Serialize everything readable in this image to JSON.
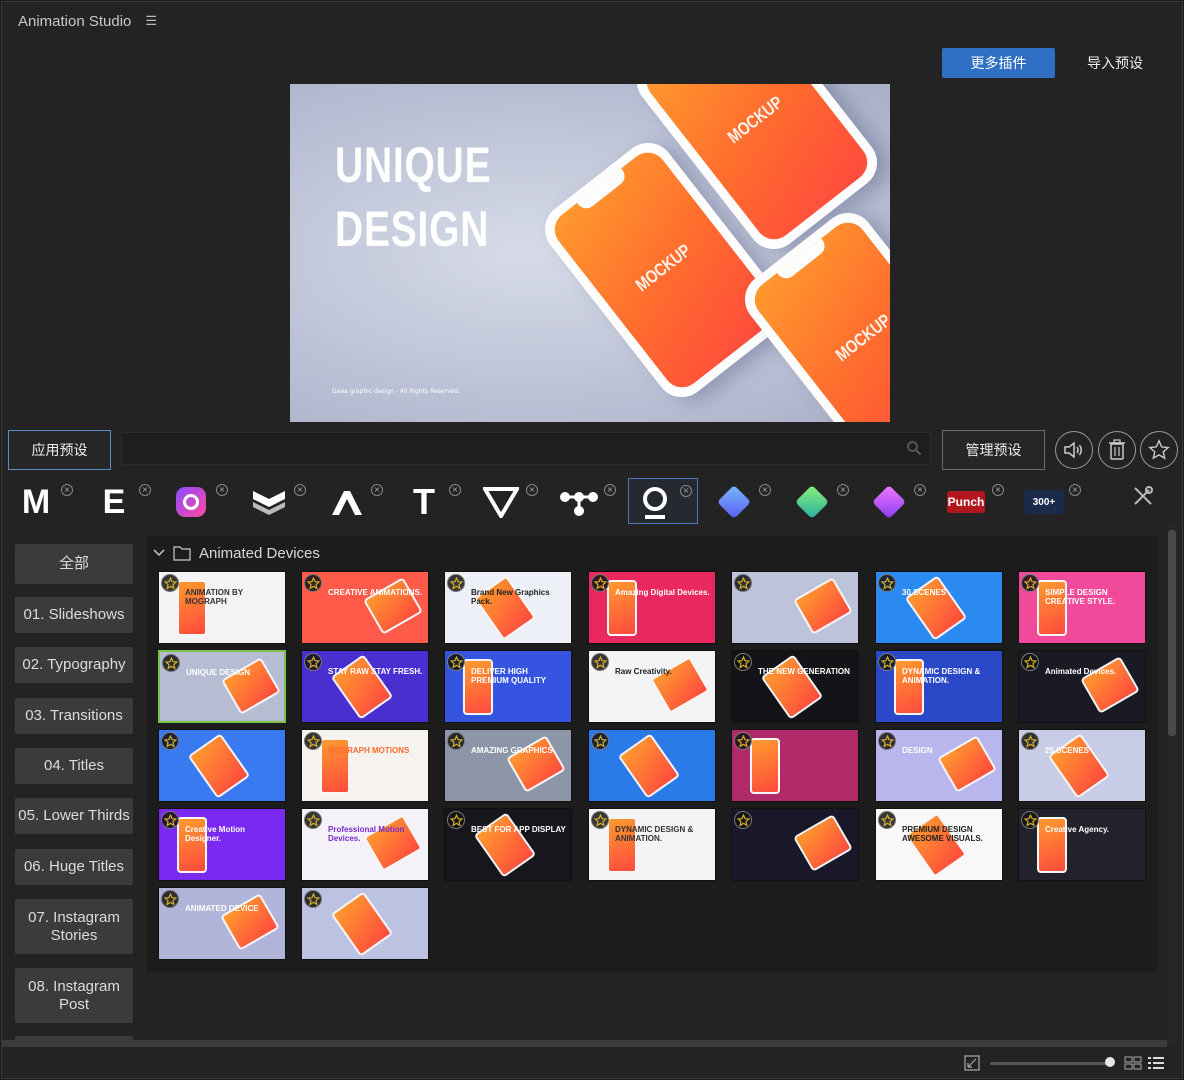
{
  "app": {
    "title": "Animation Studio"
  },
  "header": {
    "more_plugins": "更多插件",
    "import_presets": "导入预设"
  },
  "preview": {
    "line1": "UNIQUE",
    "line2": "DESIGN",
    "footer": "Gaaa graphic design - All Rights Reserved.",
    "phone_label": "MOCKUP"
  },
  "toolbar": {
    "apply_preset": "应用预设",
    "search_value": "",
    "manage_presets": "管理预设"
  },
  "plugins": [
    {
      "icon": "m-logo-icon",
      "label": "M"
    },
    {
      "icon": "e-logo-icon",
      "label": "E"
    },
    {
      "icon": "instagram-icon",
      "label": ""
    },
    {
      "icon": "chevron-badge-icon",
      "label": ""
    },
    {
      "icon": "a-logo-icon",
      "label": ""
    },
    {
      "icon": "t-logo-icon",
      "label": "T"
    },
    {
      "icon": "v-logo-icon",
      "label": ""
    },
    {
      "icon": "nodes-icon",
      "label": ""
    },
    {
      "icon": "o-logo-icon",
      "label": ""
    },
    {
      "icon": "cube-blue-icon",
      "label": ""
    },
    {
      "icon": "cube-green-icon",
      "label": ""
    },
    {
      "icon": "cube-purple-icon",
      "label": ""
    },
    {
      "icon": "punch-logo-icon",
      "label": "Punch"
    },
    {
      "icon": "text-titles-icon",
      "label": "300+"
    }
  ],
  "categories": [
    {
      "label": "全部"
    },
    {
      "label": "01. Slideshows"
    },
    {
      "label": "02. Typography"
    },
    {
      "label": "03. Transitions"
    },
    {
      "label": "04. Titles"
    },
    {
      "label": "05. Lower Thirds"
    },
    {
      "label": "06. Huge Titles"
    },
    {
      "label": "07. Instagram Stories"
    },
    {
      "label": "08. Instagram Post"
    }
  ],
  "folder": {
    "name": "Animated Devices"
  },
  "thumbnails": [
    {
      "text": "ANIMATION BY MOGRAPH",
      "bg": "#f3f3f5",
      "fg": "#333333"
    },
    {
      "text": "CREATIVE ANIMATIONS.",
      "bg": "#ff5a4a",
      "fg": "#ffffff"
    },
    {
      "text": "Brand New Graphics Pack.",
      "bg": "#eef0f7",
      "fg": "#222222"
    },
    {
      "text": "Amazing Digital Devices.",
      "bg": "#e8285e",
      "fg": "#ffffff"
    },
    {
      "text": "",
      "bg": "#bcc3da",
      "fg": "#ffffff"
    },
    {
      "text": "30 SCENES",
      "bg": "#2a8af0",
      "fg": "#ffffff"
    },
    {
      "text": "SIMPLE DESIGN CREATIVE STYLE.",
      "bg": "#f14a9a",
      "fg": "#ffffff"
    },
    {
      "text": "UNIQUE DESIGN",
      "bg": "#b6bdd3",
      "fg": "#ffffff"
    },
    {
      "text": "STAY RAW STAY FRESH.",
      "bg": "#4a2fd0",
      "fg": "#ffffff"
    },
    {
      "text": "DELIVER HIGH PREMIUM QUALITY",
      "bg": "#3555e0",
      "fg": "#ffffff"
    },
    {
      "text": "Raw Creativity.",
      "bg": "#f4f4f6",
      "fg": "#222222"
    },
    {
      "text": "THE NEW GENERATION",
      "bg": "#141418",
      "fg": "#ffffff"
    },
    {
      "text": "DYNAMIC DESIGN & ANIMATION.",
      "bg": "#2a48c8",
      "fg": "#ffffff"
    },
    {
      "text": "Animated Devices.",
      "bg": "#1a1a24",
      "fg": "#ffffff"
    },
    {
      "text": "",
      "bg": "#3a7af0",
      "fg": "#ffffff"
    },
    {
      "text": "MOGRAPH MOTIONS",
      "bg": "#f6f2ee",
      "fg": "#ff6a2e"
    },
    {
      "text": "AMAZING GRAPHICS",
      "bg": "#8c96a8",
      "fg": "#ffffff"
    },
    {
      "text": "",
      "bg": "#2a7ae8",
      "fg": "#ffffff"
    },
    {
      "text": "",
      "bg": "#b02a6a",
      "fg": "#ffffff"
    },
    {
      "text": "DESIGN",
      "bg": "#b8b6ec",
      "fg": "#ffffff"
    },
    {
      "text": "25 SCENES",
      "bg": "#c8cce6",
      "fg": "#ffffff"
    },
    {
      "text": "Creative Motion Designer.",
      "bg": "#7a2af0",
      "fg": "#ffffff"
    },
    {
      "text": "Professional Motion Devices.",
      "bg": "#f4f2f8",
      "fg": "#7a2ad0"
    },
    {
      "text": "BEST FOR APP DISPLAY",
      "bg": "#16161c",
      "fg": "#ffffff"
    },
    {
      "text": "DYNAMIC DESIGN & ANIMATION.",
      "bg": "#f4f4f6",
      "fg": "#333333"
    },
    {
      "text": "",
      "bg": "#18182a",
      "fg": "#ffffff"
    },
    {
      "text": "PREMIUM DESIGN AWESOME VISUALS.",
      "bg": "#f8f8f8",
      "fg": "#222222"
    },
    {
      "text": "Creative Agency.",
      "bg": "#22222c",
      "fg": "#ffffff"
    },
    {
      "text": "ANIMATED DEVICE",
      "bg": "#b0b4d8",
      "fg": "#ffffff"
    },
    {
      "text": "",
      "bg": "#bcc2e2",
      "fg": "#ffffff"
    }
  ]
}
